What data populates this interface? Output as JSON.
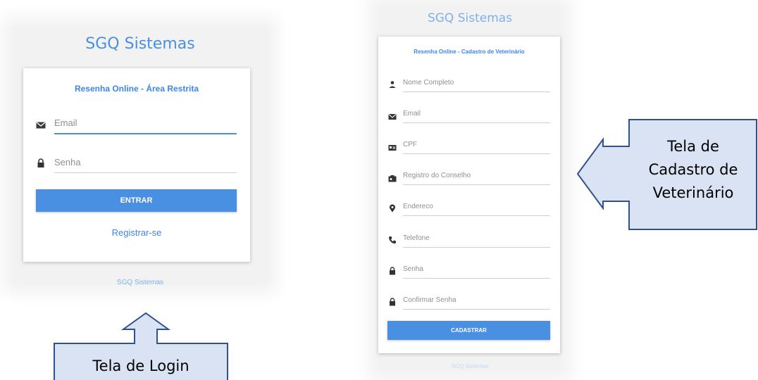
{
  "login": {
    "brand": "SGQ Sistemas",
    "card_title": "Resenha Online - Área Restrita",
    "fields": [
      {
        "icon": "envelope-icon",
        "placeholder": "Email"
      },
      {
        "icon": "lock-icon",
        "placeholder": "Senha"
      }
    ],
    "submit_label": "ENTRAR",
    "register_link": "Registrar-se",
    "footer": "SGQ Sistemas"
  },
  "register": {
    "brand": "SGQ Sistemas",
    "card_title": "Resenha Online - Cadastro de Veterinário",
    "fields": [
      {
        "icon": "person-icon",
        "placeholder": "Nome Completo"
      },
      {
        "icon": "envelope-icon",
        "placeholder": "Email"
      },
      {
        "icon": "id-card-icon",
        "placeholder": "CPF"
      },
      {
        "icon": "badge-icon",
        "placeholder": "Registro do Conselho"
      },
      {
        "icon": "map-pin-icon",
        "placeholder": "Endereco"
      },
      {
        "icon": "phone-icon",
        "placeholder": "Telefone"
      },
      {
        "icon": "lock-icon",
        "placeholder": "Senha"
      },
      {
        "icon": "lock-icon",
        "placeholder": "Confirmar Senha"
      }
    ],
    "submit_label": "CADASTRAR",
    "footer": "SGQ Sistemas"
  },
  "callouts": {
    "register_lines": [
      "Tela de",
      "Cadastro de",
      "Veterinário"
    ],
    "login_label": "Tela de Login"
  },
  "colors": {
    "accent": "#4a90e2",
    "callout_fill": "#dae3f3",
    "callout_border": "#2f528f"
  }
}
